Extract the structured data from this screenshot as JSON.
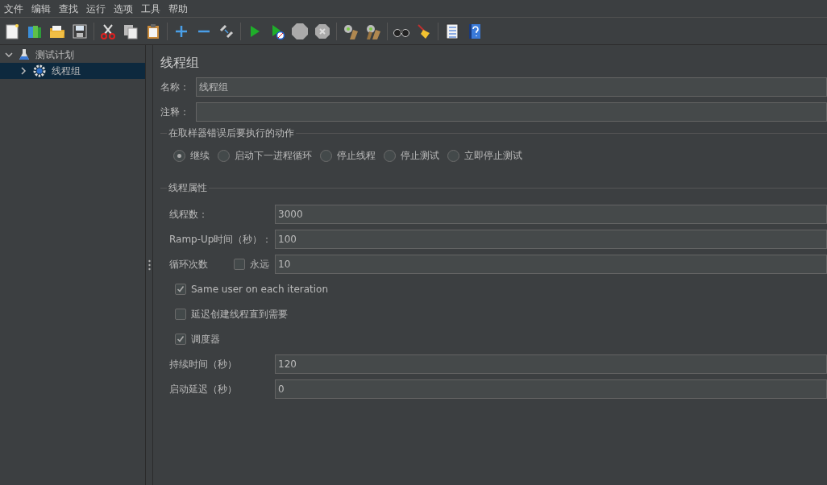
{
  "menu": [
    "文件",
    "编辑",
    "查找",
    "运行",
    "选项",
    "工具",
    "帮助"
  ],
  "tree": [
    {
      "label": "测试计划",
      "expanded": true,
      "selected": false,
      "children": [
        {
          "label": "线程组",
          "expanded": false,
          "selected": true
        }
      ]
    }
  ],
  "panel": {
    "title": "线程组",
    "name_label": "名称：",
    "name_value": "线程组",
    "comment_label": "注释：",
    "error_action": {
      "title": "在取样器错误后要执行的动作",
      "options": [
        {
          "label": "继续",
          "selected": true
        },
        {
          "label": "启动下一进程循环",
          "selected": false
        },
        {
          "label": "停止线程",
          "selected": false
        },
        {
          "label": "停止测试",
          "selected": false
        },
        {
          "label": "立即停止测试",
          "selected": false
        }
      ]
    },
    "thread_props": {
      "title": "线程属性",
      "rows": [
        {
          "kind": "field",
          "label": "线程数：",
          "value": "3000"
        },
        {
          "kind": "field",
          "label": "Ramp-Up时间（秒）：",
          "value": "100"
        },
        {
          "kind": "loop",
          "label": "循环次数",
          "checkbox_label": "永远",
          "checked": false,
          "value": "10"
        },
        {
          "kind": "checkbox",
          "label": "Same user on each iteration",
          "checked": true
        },
        {
          "kind": "checkbox",
          "label": "延迟创建线程直到需要",
          "checked": false
        },
        {
          "kind": "checkbox",
          "label": "调度器",
          "checked": true
        },
        {
          "kind": "field",
          "label": "持续时间（秒）",
          "value": "120"
        },
        {
          "kind": "field",
          "label": "启动延迟（秒）",
          "value": "0"
        }
      ]
    }
  }
}
